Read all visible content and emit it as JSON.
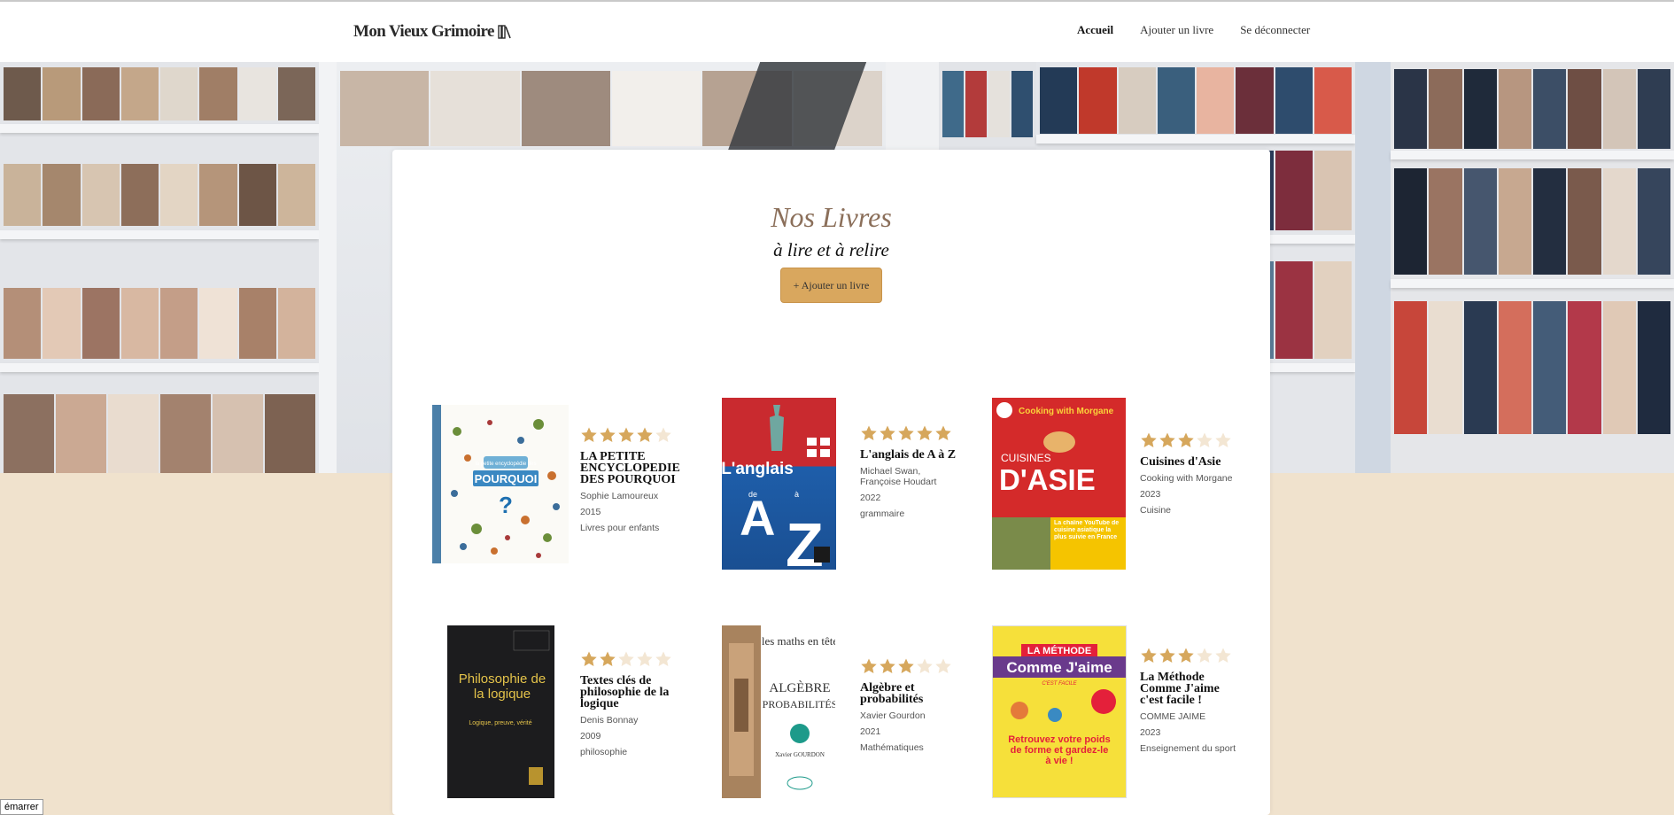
{
  "header": {
    "logo_text": "Mon Vieux Grimoire",
    "nav": [
      {
        "label": "Accueil",
        "active": true
      },
      {
        "label": "Ajouter un livre",
        "active": false
      },
      {
        "label": "Se déconnecter",
        "active": false
      }
    ]
  },
  "main": {
    "title": "Nos Livres",
    "subtitle": "à lire et à relire",
    "add_button": "+ Ajouter un livre"
  },
  "books": [
    {
      "title": "LA PETITE ENCYCLOPEDIE DES POURQUOI",
      "author": "Sophie Lamoureux",
      "year": "2015",
      "genre": "Livres pour enfants",
      "rating": 4,
      "cover_text": [
        "la petite encyclopédie des",
        "POURQUOI",
        "?"
      ]
    },
    {
      "title": "L'anglais de A à Z",
      "author": "Michael Swan, Françoise Houdart",
      "year": "2022",
      "genre": "grammaire",
      "rating": 5,
      "cover_text": [
        "L'anglais",
        "de",
        "A",
        "à",
        "Z"
      ]
    },
    {
      "title": "Cuisines d'Asie",
      "author": "Cooking with Morgane",
      "year": "2023",
      "genre": "Cuisine",
      "rating": 3,
      "cover_text": [
        "Cooking with Morgane",
        "CUISINES",
        "D'ASIE",
        "La chaîne YouTube de cuisine asiatique la plus suivie en France"
      ]
    },
    {
      "title": "Textes clés de philosophie de la logique",
      "author": "Denis Bonnay",
      "year": "2009",
      "genre": "philosophie",
      "rating": 2,
      "cover_text": [
        "Philosophie de la logique",
        "Logique, preuve, vérité"
      ]
    },
    {
      "title": "Algèbre et probabilités",
      "author": "Xavier Gourdon",
      "year": "2021",
      "genre": "Mathématiques",
      "rating": 3,
      "cover_text": [
        "les maths en tête",
        "ALGÈBRE",
        "PROBABILITÉS",
        "Xavier GOURDON"
      ]
    },
    {
      "title": "La Méthode Comme J'aime c'est facile !",
      "author": "COMME JAIME",
      "year": "2023",
      "genre": "Enseignement du sport",
      "rating": 3,
      "cover_text": [
        "LA MÉTHODE",
        "Comme J'aime",
        "C'EST FACILE",
        "Retrouvez votre poids de forme et gardez-le à vie !"
      ]
    }
  ],
  "colors": {
    "star_filled": "#d6a75c",
    "star_empty": "#f3e6d3",
    "accent_button": "#d9a75e",
    "page_bg": "#f0e2cd"
  },
  "taskbar": {
    "start_label": "émarrer"
  }
}
